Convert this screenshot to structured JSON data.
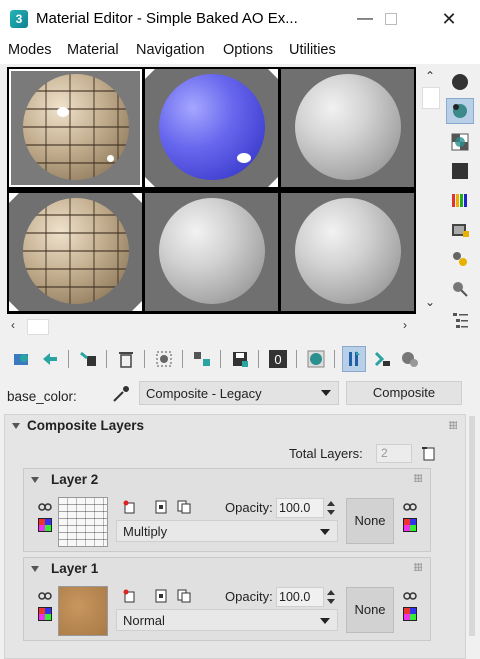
{
  "window": {
    "title": "Material Editor - Simple Baked AO Ex...",
    "controls": [
      "minimize",
      "maximize",
      "close"
    ]
  },
  "menu": [
    "Modes",
    "Material",
    "Navigation",
    "Options",
    "Utilities"
  ],
  "sample_slots": [
    {
      "name": "brick-ao",
      "active": true
    },
    {
      "name": "blue",
      "active": false
    },
    {
      "name": "gray",
      "active": false
    },
    {
      "name": "brick",
      "active": false
    },
    {
      "name": "gray",
      "active": false
    },
    {
      "name": "gray",
      "active": false
    }
  ],
  "side_tools": [
    "sample-type-icon",
    "backlight-icon",
    "background-icon",
    "uv-tiling-icon",
    "video-color-check-icon",
    "make-preview-icon",
    "options-icon",
    "select-by-material-icon",
    "material-map-navigator-icon"
  ],
  "toolbar_icons": [
    "get-material-icon",
    "put-to-scene-icon",
    "assign-to-selection-icon",
    "reset-icon",
    "make-copy-icon",
    "make-unique-icon",
    "put-to-library-icon",
    "material-id-channel-icon",
    "show-shaded-in-viewport-icon",
    "show-end-result-icon",
    "go-to-parent-icon",
    "go-forward-icon"
  ],
  "material_id": "0",
  "material": {
    "name_label": "base_color:",
    "type_dropdown": "Composite - Legacy",
    "type_button": "Composite"
  },
  "rollout": {
    "title": "Composite Layers",
    "total_layers_label": "Total Layers:",
    "total_layers_value": "2"
  },
  "layers": [
    {
      "title": "Layer 2",
      "opacity_label": "Opacity:",
      "opacity": "100.0",
      "blend": "Multiply",
      "mask": "None"
    },
    {
      "title": "Layer 1",
      "opacity_label": "Opacity:",
      "opacity": "100.0",
      "blend": "Normal",
      "mask": "None"
    }
  ]
}
